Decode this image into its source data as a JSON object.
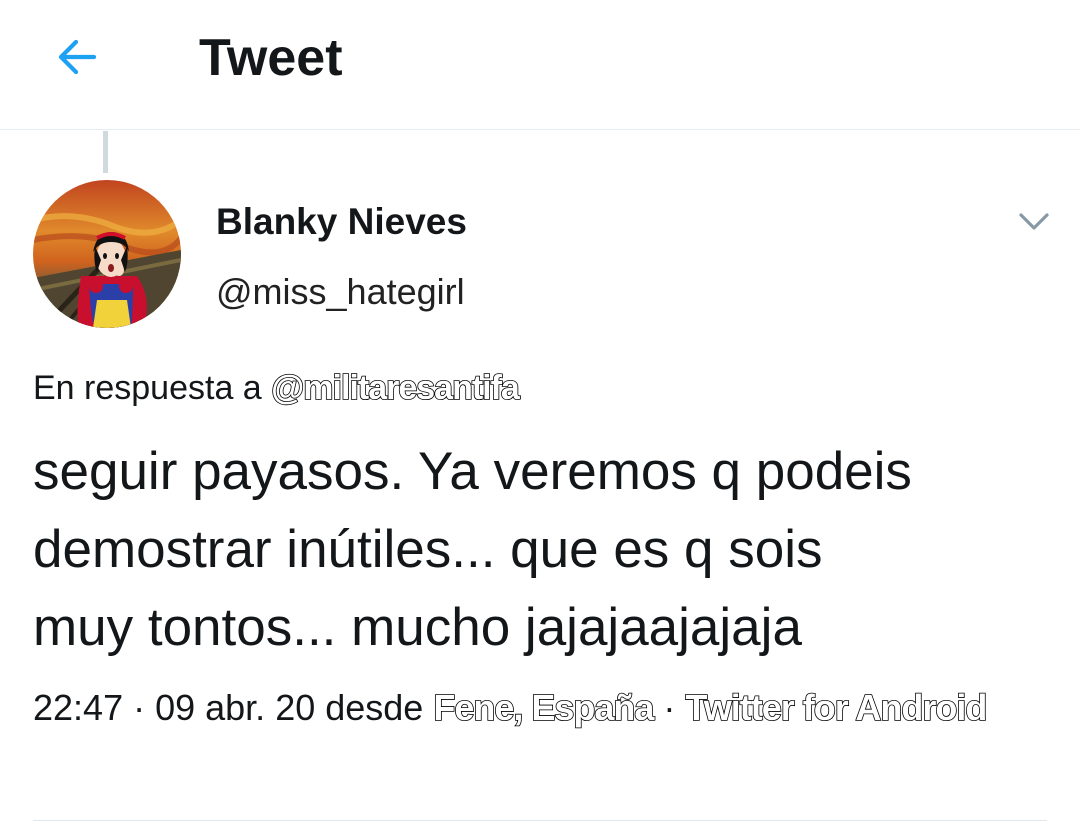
{
  "header": {
    "title": "Tweet",
    "back_icon": "arrow-left-icon",
    "accent_color": "#1da1f2"
  },
  "tweet": {
    "author": {
      "display_name": "Blanky Nieves",
      "handle": "@miss_hategirl",
      "avatar": "avatar-image"
    },
    "menu_icon": "chevron-down-icon",
    "reply_prefix": "En respuesta a ",
    "reply_to": "@militaresantifa",
    "text": "seguir payasos. Ya veremos q podeis\ndemostrar inútiles...  que es q sois\nmuy tontos... mucho jajajaajajaja",
    "time": "22:47",
    "separator_1": " · ",
    "date": "09 abr. 20",
    "from_label": " desde ",
    "location": "Fene, España",
    "separator_2": " · ",
    "client": "Twitter for Android"
  }
}
